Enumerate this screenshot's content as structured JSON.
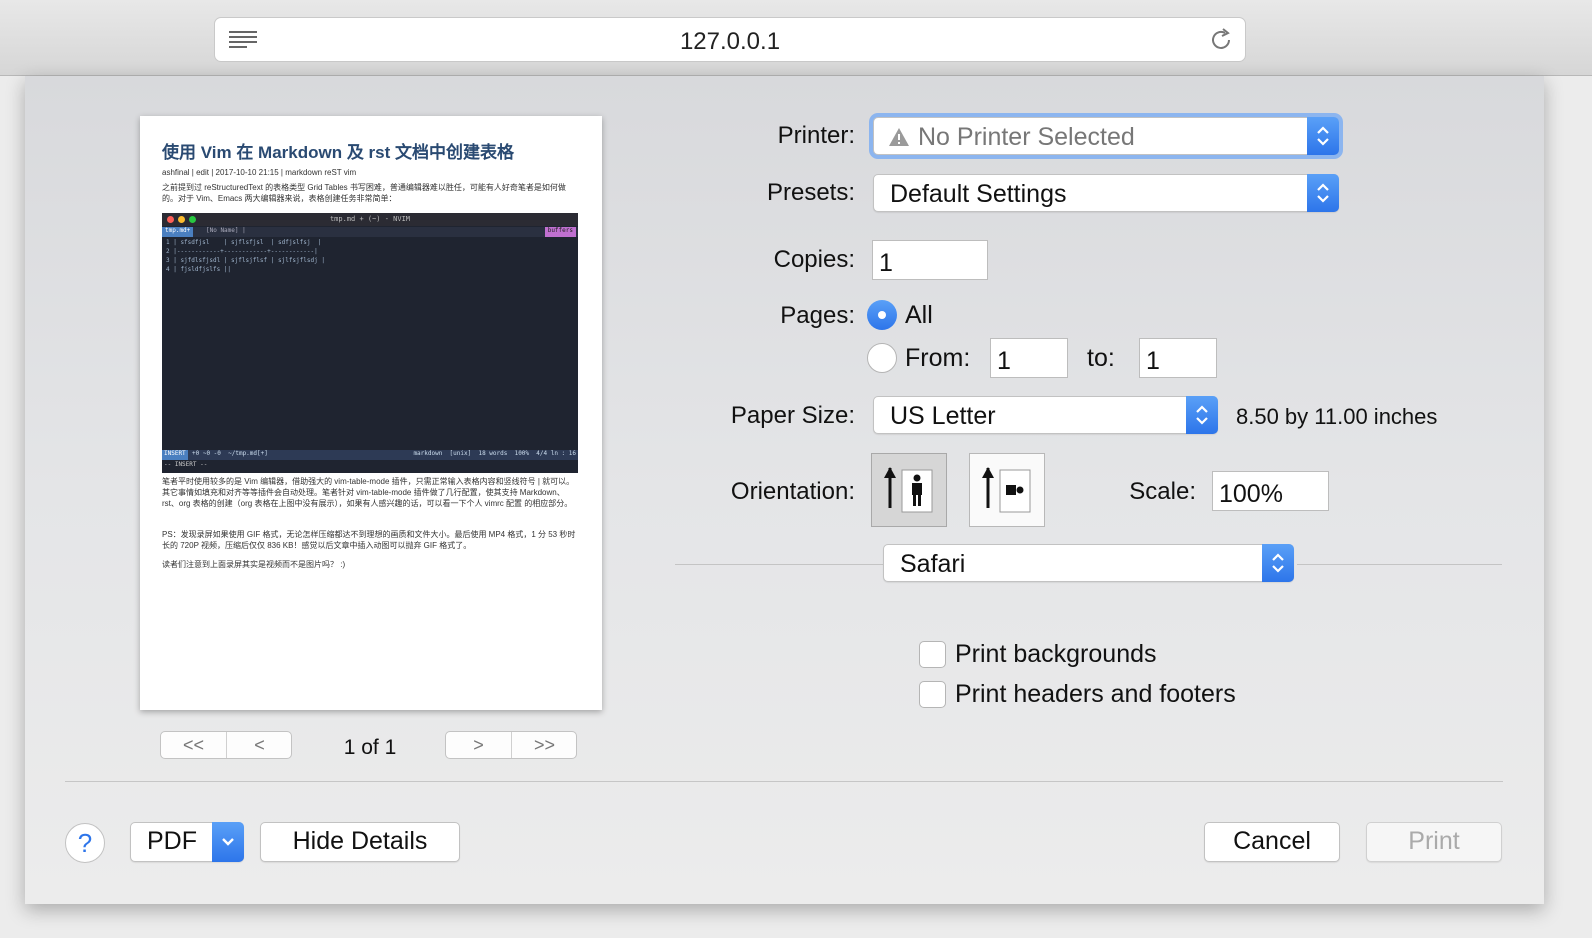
{
  "browser": {
    "url": "127.0.0.1"
  },
  "preview": {
    "title": "使用 Vim 在 Markdown 及 rst 文档中创建表格",
    "meta": "ashfinal | edit | 2017-10-10 21:15 | markdown reST vim",
    "para1": "之前提到过 reStructuredText 的表格类型 Grid Tables 书写困难，普通编辑器难以胜任，可能有人好奇笔者是如何做的。对于 Vim、Emacs 两大编辑器来说，表格创建任务非常简单：",
    "terminal": {
      "title": "tmp.md + (~) - NVIM",
      "tab_active": "tmp.md+",
      "tab_other": "[No Name] |",
      "buffers_label": "buffers",
      "lines": [
        "1 | sfsdfjsl    | sjflsfjsl  | sdfjslfsj  |",
        "2 |------------+------------+------------|",
        "3 | sjfdlsfjsdl | sjflsjflsf | sjlfsjflsdj |",
        "4 | fjsldfjslfs ||"
      ],
      "status_mode": "INSERT",
      "status_mid": "+0 ~0 -0  ~/tmp.md[+]",
      "status_right": "markdown  [unix]  18 words  100%  4/4 ln : 16",
      "insert_line": "-- INSERT --"
    },
    "para2": "笔者平时使用较多的是 Vim 编辑器，借助强大的 vim-table-mode 插件，只需正常输入表格内容和竖线符号 | 就可以。其它事情如填充和对齐等等插件会自动处理。笔者针对 vim-table-mode 插件做了几行配置，使其支持 Markdown、rst、org 表格的创建（org 表格在上图中没有展示），如果有人感兴趣的话，可以看一下个人 vimrc 配置 的相应部分。",
    "para3": "PS：发现录屏如果使用 GIF 格式，无论怎样压缩都达不到理想的画质和文件大小。最后使用 MP4 格式，1 分 53 秒时长的 720P 视频，压缩后仅仅 836 KB！感觉以后文章中插入动图可以抛弃 GIF 格式了。",
    "para4": "读者们注意到上面录屏其实是视频而不是图片吗？ :)"
  },
  "pagination": {
    "first": "<<",
    "prev": "<",
    "next": ">",
    "last": ">>",
    "label": "1 of 1"
  },
  "form": {
    "printer_label": "Printer:",
    "printer_value": "No Printer Selected",
    "presets_label": "Presets:",
    "presets_value": "Default Settings",
    "copies_label": "Copies:",
    "copies_value": "1",
    "pages_label": "Pages:",
    "pages_all": "All",
    "pages_from": "From:",
    "pages_from_value": "1",
    "pages_to": "to:",
    "pages_to_value": "1",
    "paper_label": "Paper Size:",
    "paper_value": "US Letter",
    "paper_dims": "8.50 by 11.00 inches",
    "orientation_label": "Orientation:",
    "scale_label": "Scale:",
    "scale_value": "100%",
    "section_value": "Safari",
    "print_backgrounds": "Print backgrounds",
    "print_headers": "Print headers and footers"
  },
  "buttons": {
    "help": "?",
    "pdf": "PDF",
    "hide_details": "Hide Details",
    "cancel": "Cancel",
    "print": "Print"
  },
  "colors": {
    "accent": "#2d75ea",
    "focus_ring": "#8cb5ef"
  }
}
